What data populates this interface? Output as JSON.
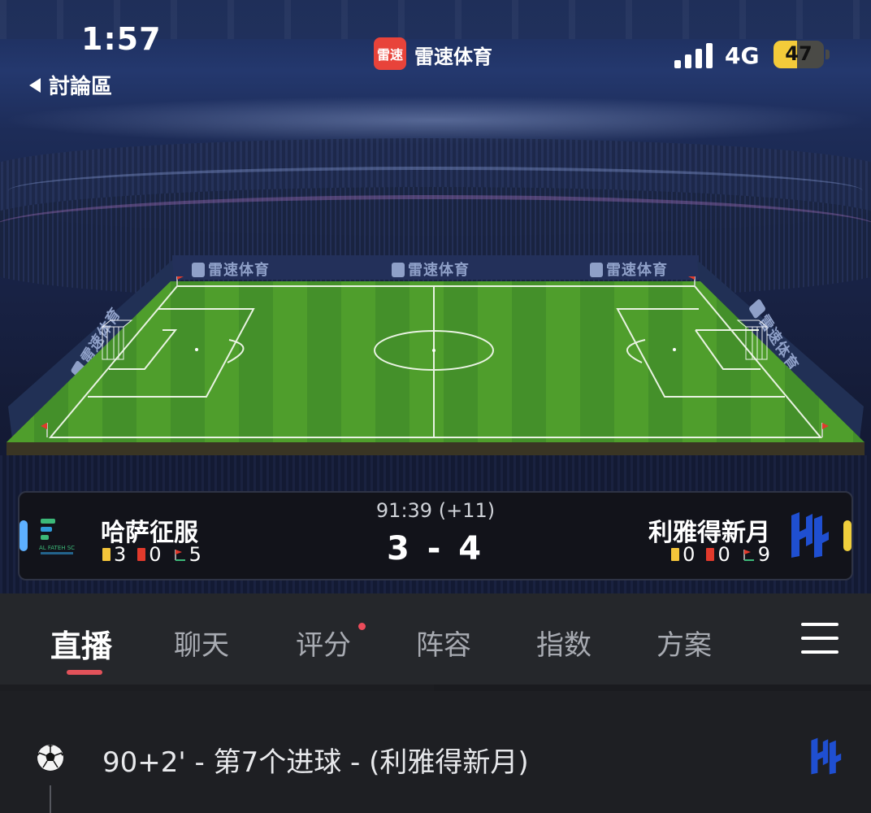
{
  "status_bar": {
    "time": "1:57",
    "back_label": "討論區",
    "app_logo_text": "雷速",
    "app_name": "雷速体育",
    "network": "4G",
    "battery_level": "47",
    "battery_fraction": 0.47
  },
  "pitch": {
    "ad_text": "雷速体育"
  },
  "match": {
    "clock": "91:39 (+11)",
    "score": "3 - 4",
    "home": {
      "name": "哈萨征服",
      "crest_text": "AL FATEH SC",
      "yellow_cards": "3",
      "red_cards": "0",
      "corners": "5",
      "color": "#5db0ff"
    },
    "away": {
      "name": "利雅得新月",
      "yellow_cards": "0",
      "red_cards": "0",
      "corners": "9",
      "color": "#f0cf3c"
    }
  },
  "tabs": [
    {
      "label": "直播",
      "active": true
    },
    {
      "label": "聊天",
      "active": false
    },
    {
      "label": "评分",
      "active": false,
      "badge": true
    },
    {
      "label": "阵容",
      "active": false
    },
    {
      "label": "指数",
      "active": false
    },
    {
      "label": "方案",
      "active": false
    }
  ],
  "menu_icon": "hamburger-menu-icon",
  "events": [
    {
      "text": "90+2' - 第7个进球 - (利雅得新月)",
      "icon": "soccer-ball-icon",
      "team_icon": "al-hilal-crest-icon"
    }
  ],
  "colors": {
    "accent_red": "#e2525a",
    "pitch_green": "#4b9a2a",
    "tab_bar_bg": "#25272b"
  }
}
